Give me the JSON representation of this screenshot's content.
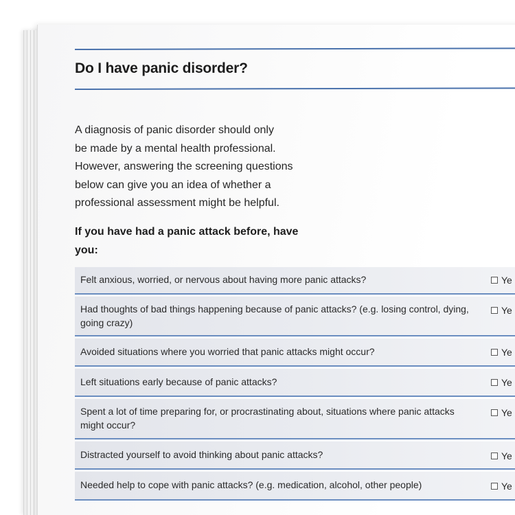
{
  "document": {
    "title": "Do I have panic disorder?",
    "intro_lines": [
      "A diagnosis of panic disorder should only",
      "be made by a mental health professional.",
      "However, answering the screening questions",
      "below can give you an idea of whether a",
      "professional assessment might be helpful."
    ],
    "prompt_lines": [
      "If you have had a panic attack before, have",
      "you:"
    ],
    "questions": [
      {
        "text": "Felt anxious, worried, or nervous about having more panic attacks?",
        "option": "Ye"
      },
      {
        "text": "Had thoughts of bad things happening because of panic attacks? (e.g. losing control, dying, going crazy)",
        "option": "Ye"
      },
      {
        "text": "Avoided situations where you worried that panic attacks might occur?",
        "option": "Ye"
      },
      {
        "text": "Left situations early because of panic attacks?",
        "option": "Ye"
      },
      {
        "text": "Spent a lot of time preparing for, or procrastinating about, situations where panic attacks might occur?",
        "option": "Ye"
      },
      {
        "text": "Distracted yourself to avoid thinking about panic attacks?",
        "option": "Ye"
      },
      {
        "text": "Needed help to cope with panic attacks? (e.g. medication, alcohol, other people)",
        "option": "Ye"
      }
    ],
    "colors": {
      "rule": "#4a72ac",
      "row_border": "#6a8dc0",
      "row_fill": "#e6e8ed"
    }
  }
}
